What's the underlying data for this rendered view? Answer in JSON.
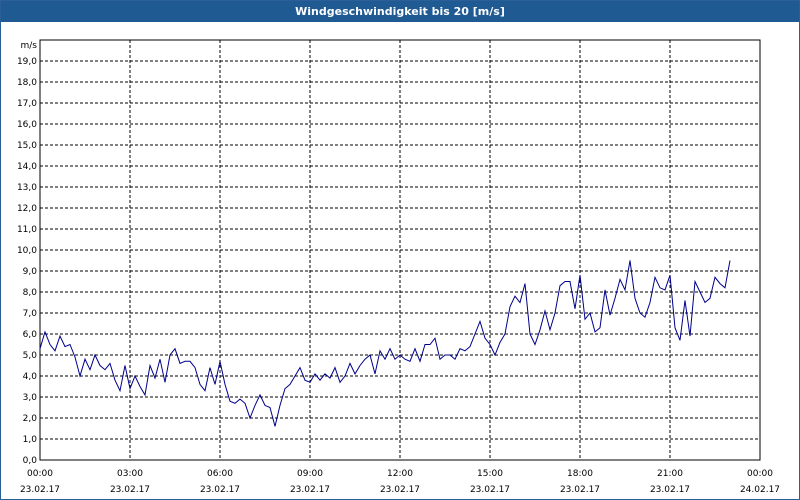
{
  "window": {
    "title": "Windgeschwindigkeit bis 20 [m/s]"
  },
  "colors": {
    "series": "#00008b",
    "grid": "#000000",
    "titlebar": "#1f5a93"
  },
  "chart_data": {
    "type": "line",
    "title": "Windgeschwindigkeit bis 20 [m/s]",
    "ylabel": "m/s",
    "xlabel": "",
    "ylim": [
      0,
      20
    ],
    "y_ticks": [
      "0,0",
      "1,0",
      "2,0",
      "3,0",
      "4,0",
      "5,0",
      "6,0",
      "7,0",
      "8,0",
      "9,0",
      "10,0",
      "11,0",
      "12,0",
      "13,0",
      "14,0",
      "15,0",
      "16,0",
      "17,0",
      "18,0",
      "19,0"
    ],
    "x_ticks": [
      {
        "time": "00:00",
        "date": "23.02.17"
      },
      {
        "time": "03:00",
        "date": "23.02.17"
      },
      {
        "time": "06:00",
        "date": "23.02.17"
      },
      {
        "time": "09:00",
        "date": "23.02.17"
      },
      {
        "time": "12:00",
        "date": "23.02.17"
      },
      {
        "time": "15:00",
        "date": "23.02.17"
      },
      {
        "time": "18:00",
        "date": "23.02.17"
      },
      {
        "time": "21:00",
        "date": "23.02.17"
      },
      {
        "time": "00:00",
        "date": "24.02.17"
      }
    ],
    "grid": true,
    "series": [
      {
        "interval_minutes": 10,
        "values": [
          5.3,
          6.1,
          5.5,
          5.2,
          5.9,
          5.4,
          5.5,
          4.9,
          4.0,
          4.8,
          4.3,
          5.0,
          4.5,
          4.3,
          4.6,
          3.8,
          3.3,
          4.5,
          3.4,
          4.0,
          3.5,
          3.1,
          4.5,
          3.9,
          4.8,
          3.7,
          5.0,
          5.3,
          4.6,
          4.7,
          4.7,
          4.4,
          3.6,
          3.3,
          4.4,
          3.6,
          4.7,
          3.6,
          2.8,
          2.7,
          2.9,
          2.7,
          2.0,
          2.6,
          3.1,
          2.6,
          2.5,
          1.6,
          2.6,
          3.4,
          3.6,
          4.0,
          4.4,
          3.8,
          3.7,
          4.1,
          3.8,
          4.1,
          3.9,
          4.4,
          3.7,
          4.0,
          4.6,
          4.1,
          4.5,
          4.8,
          5.0,
          4.1,
          5.2,
          4.8,
          5.3,
          4.8,
          5.0,
          4.8,
          4.7,
          5.3,
          4.7,
          5.5,
          5.5,
          5.8,
          4.8,
          5.0,
          5.0,
          4.8,
          5.3,
          5.2,
          5.4,
          6.0,
          6.6,
          5.8,
          5.5,
          5.0,
          5.6,
          6.0,
          7.3,
          7.8,
          7.5,
          8.4,
          6.0,
          5.5,
          6.2,
          7.1,
          6.2,
          7.0,
          8.3,
          8.5,
          8.5,
          7.2,
          8.8,
          6.7,
          7.0,
          6.1,
          6.3,
          8.1,
          6.9,
          7.7,
          8.6,
          8.1,
          9.5,
          7.7,
          7.0,
          6.8,
          7.5,
          8.7,
          8.2,
          8.1,
          8.8,
          6.3,
          5.7,
          7.6,
          5.9,
          8.5,
          8.0,
          7.5,
          7.7,
          8.7,
          8.4,
          8.2,
          9.5
        ]
      }
    ]
  }
}
